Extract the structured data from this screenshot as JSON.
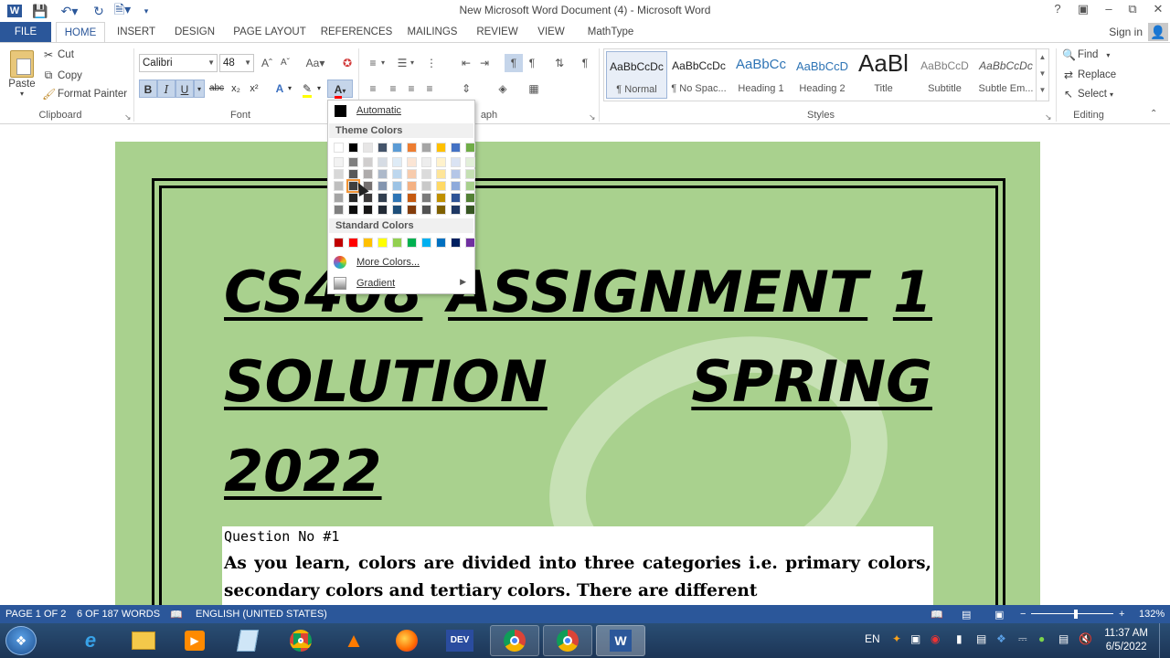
{
  "window": {
    "title": "New Microsoft Word Document (4) - Microsoft Word",
    "help": "?",
    "minimize": "–",
    "restore": "⧉",
    "close": "✕"
  },
  "quick_access": [
    "save-icon",
    "undo-icon",
    "redo-icon",
    "new-doc-icon",
    "customize-icon"
  ],
  "tabs": [
    "FILE",
    "HOME",
    "INSERT",
    "DESIGN",
    "PAGE LAYOUT",
    "REFERENCES",
    "MAILINGS",
    "REVIEW",
    "VIEW",
    "MathType"
  ],
  "active_tab": "HOME",
  "sign_in": "Sign in",
  "clipboard": {
    "paste": "Paste",
    "cut": "Cut",
    "copy": "Copy",
    "format_painter": "Format Painter",
    "label": "Clipboard"
  },
  "font": {
    "name": "Calibri",
    "size": "48",
    "case_button": "Aa",
    "bold": "B",
    "italic": "I",
    "underline": "U",
    "strike": "abc",
    "sub": "x₂",
    "sup": "x²",
    "label": "Font"
  },
  "paragraph": {
    "label": "Paragraph",
    "visible_label": "aph"
  },
  "styles": {
    "label": "Styles",
    "items": [
      {
        "preview": "AaBbCcDc",
        "name": "¶ Normal"
      },
      {
        "preview": "AaBbCcDc",
        "name": "¶ No Spac..."
      },
      {
        "preview": "AaBbCc",
        "name": "Heading 1"
      },
      {
        "preview": "AaBbCcD",
        "name": "Heading 2"
      },
      {
        "preview": "AaBl",
        "name": "Title"
      },
      {
        "preview": "AaBbCcD",
        "name": "Subtitle"
      },
      {
        "preview": "AaBbCcDc",
        "name": "Subtle Em..."
      }
    ]
  },
  "editing": {
    "label": "Editing",
    "find": "Find",
    "replace": "Replace",
    "select": "Select"
  },
  "color_menu": {
    "automatic": "Automatic",
    "theme_header": "Theme Colors",
    "standard_header": "Standard Colors",
    "more_colors": "More Colors...",
    "gradient": "Gradient",
    "theme_base": [
      "#ffffff",
      "#000000",
      "#e7e6e6",
      "#44546a",
      "#5b9bd5",
      "#ed7d31",
      "#a5a5a5",
      "#ffc000",
      "#4472c4",
      "#70ad47"
    ],
    "theme_shades": [
      [
        "#f2f2f2",
        "#7f7f7f",
        "#d0cece",
        "#d6dce4",
        "#deebf6",
        "#fbe5d5",
        "#ededed",
        "#fff2cc",
        "#dae3f3",
        "#e2efd9"
      ],
      [
        "#d8d8d8",
        "#595959",
        "#aeabab",
        "#adb9ca",
        "#bdd7ee",
        "#f7cbac",
        "#dbdbdb",
        "#fee599",
        "#b4c6e7",
        "#c5e0b3"
      ],
      [
        "#bfbfbf",
        "#3f3f3f",
        "#757070",
        "#8496b0",
        "#9cc3e5",
        "#f4b183",
        "#c9c9c9",
        "#ffd965",
        "#8eaadb",
        "#a8d08d"
      ],
      [
        "#a5a5a5",
        "#262626",
        "#3a3838",
        "#323f4f",
        "#2e75b5",
        "#c55a11",
        "#7b7b7b",
        "#bf9000",
        "#2f5496",
        "#538135"
      ],
      [
        "#7f7f7f",
        "#0c0c0c",
        "#171616",
        "#222a35",
        "#1e4e79",
        "#833c0b",
        "#525252",
        "#7f6000",
        "#1f3864",
        "#375623"
      ]
    ],
    "standard": [
      "#c00000",
      "#ff0000",
      "#ffc000",
      "#ffff00",
      "#92d050",
      "#00b050",
      "#00b0f0",
      "#0070c0",
      "#002060",
      "#7030a0"
    ]
  },
  "document": {
    "title_line1": [
      "CS408",
      "ASSIGNMENT",
      "1"
    ],
    "title_line2": [
      "SOLUTION",
      "SPRING"
    ],
    "title_line3": "2022",
    "question_title": "Question No #1",
    "question_body": "As you learn, colors are divided into three categories i.e. primary colors, secondary colors and tertiary colors. There are different"
  },
  "statusbar": {
    "page": "PAGE 1 OF 2",
    "words": "6 OF 187 WORDS",
    "language": "ENGLISH (UNITED STATES)",
    "zoom_minus": "−",
    "zoom_plus": "+",
    "zoom": "132%"
  },
  "taskbar": {
    "apps": [
      "internet-explorer-icon",
      "file-explorer-icon",
      "media-player-icon",
      "notepad-icon",
      "chrome-icon",
      "vlc-icon",
      "firefox-icon",
      "dev-cpp-icon",
      "chrome-icon",
      "chrome-icon",
      "word-icon"
    ],
    "dev_label": "DEV",
    "lang": "EN",
    "time": "11:37 AM",
    "date": "6/5/2022"
  },
  "accent": "#2b579a"
}
